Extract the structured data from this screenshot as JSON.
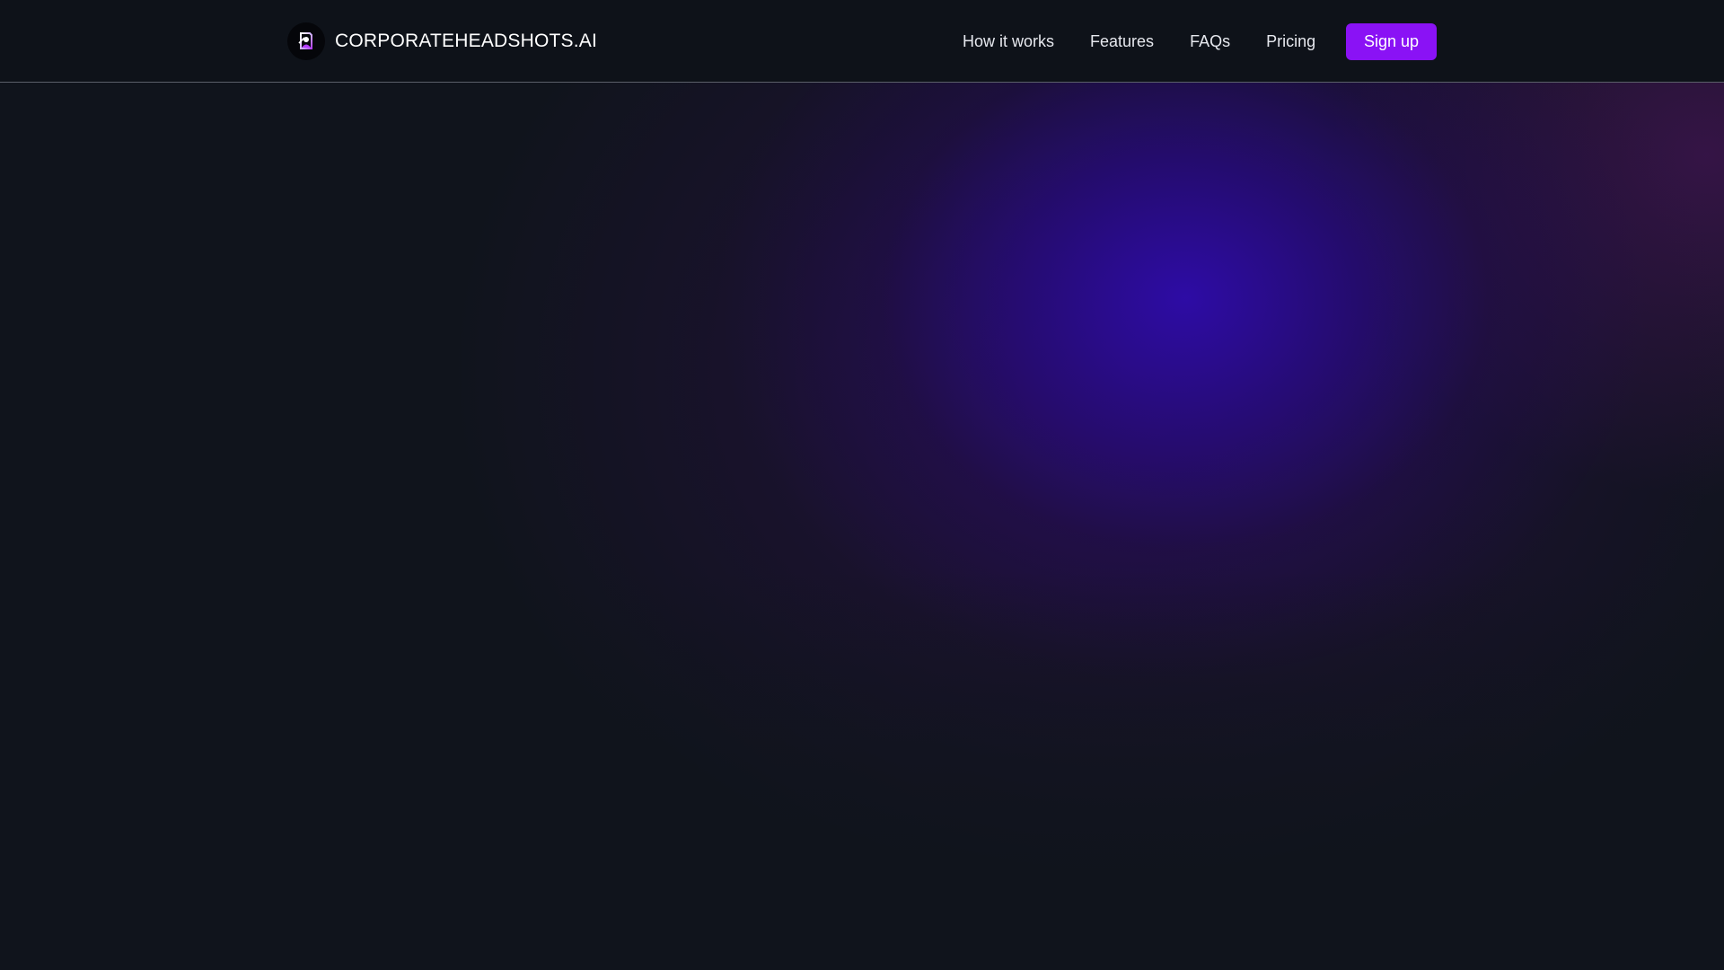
{
  "brand": {
    "name": "CORPORATEHEADSHOTS.AI",
    "logo_icon": "headshot-logo-icon"
  },
  "nav": {
    "links": [
      {
        "label": "How it works"
      },
      {
        "label": "Features"
      },
      {
        "label": "FAQs"
      },
      {
        "label": "Pricing"
      }
    ],
    "signup_label": "Sign up"
  },
  "colors": {
    "background": "#10141c",
    "navbar": "#0e1219",
    "accent": "#8a12f5",
    "glow_primary": "#2e0caa",
    "glow_secondary": "#5a1470"
  }
}
